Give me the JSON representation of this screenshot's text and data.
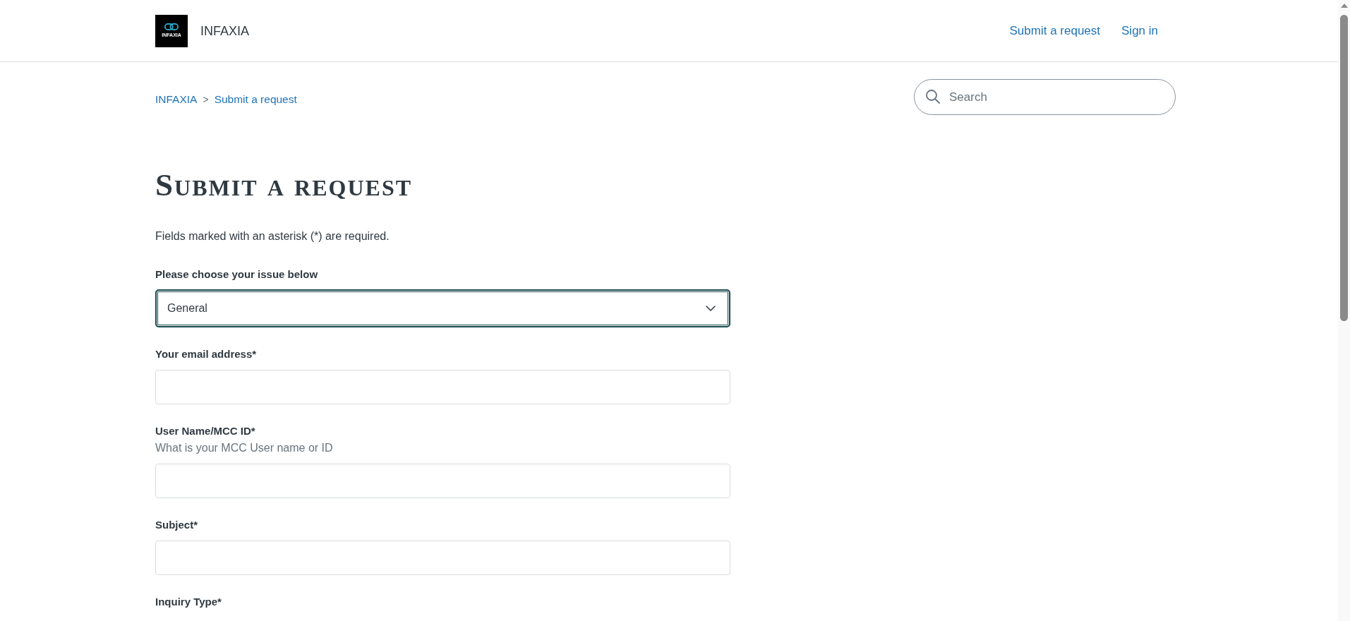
{
  "header": {
    "logo": {
      "text": "INFAXIA"
    },
    "brand": "INFAXIA",
    "nav": [
      "Submit a request",
      "Sign in"
    ]
  },
  "breadcrumb": {
    "items": [
      "INFAXIA",
      "Submit a request"
    ],
    "separator": ">"
  },
  "search": {
    "placeholder": "Search"
  },
  "page": {
    "title": "Submit a request",
    "note": "Fields marked with an asterisk (*) are required."
  },
  "form": {
    "fields": [
      {
        "kind": "select",
        "label": "Please choose your issue below",
        "value": "General",
        "focused": true
      },
      {
        "kind": "text",
        "label": "Your email address*",
        "focused": false
      },
      {
        "kind": "text",
        "label": "User Name/MCC ID*",
        "hint": "What is your MCC User name or ID",
        "focused": false
      },
      {
        "kind": "text",
        "label": "Subject*",
        "focused": false
      }
    ],
    "next_label": "Inquiry Type*"
  }
}
